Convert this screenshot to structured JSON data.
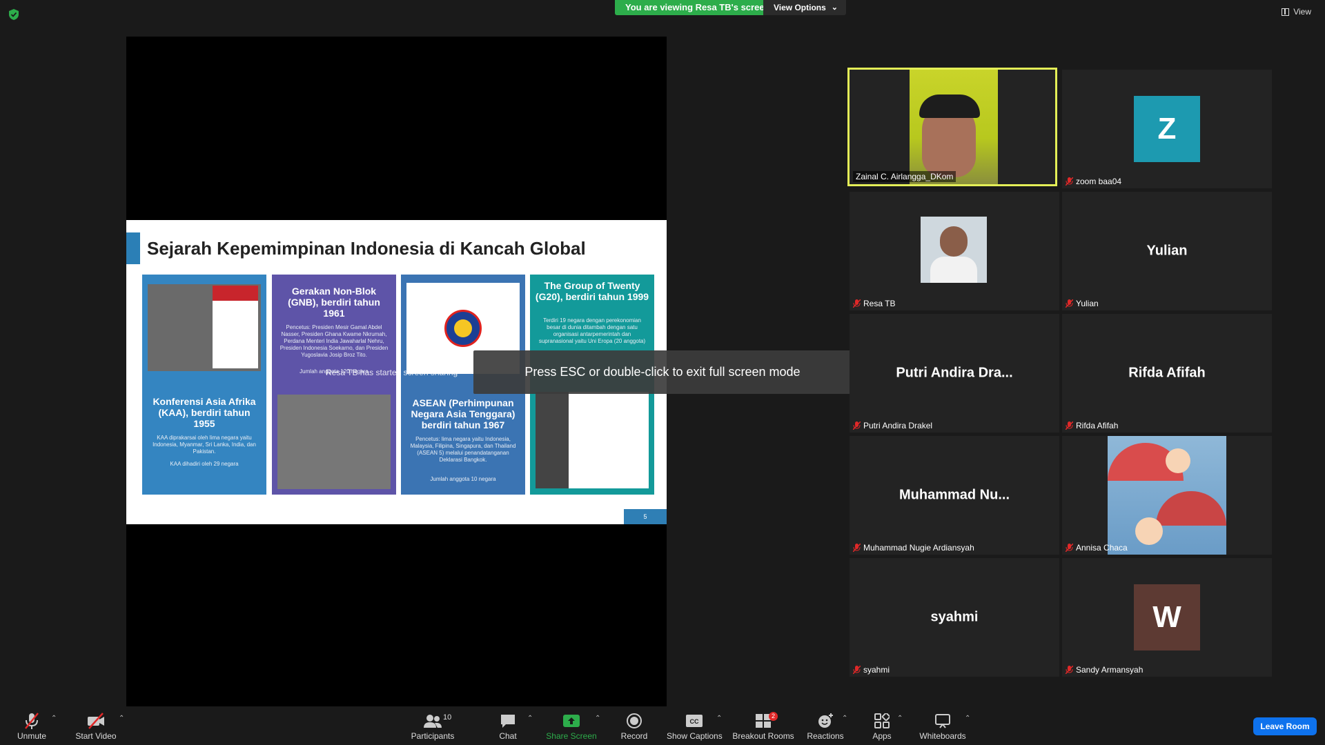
{
  "top": {
    "viewing_text": "You are viewing Resa TB's screen",
    "view_options_label": "View Options",
    "view_label": "View"
  },
  "slide": {
    "title": "Sejarah Kepemimpinan Indonesia di Kancah Global",
    "page_number": "5",
    "cards": [
      {
        "heading": "Konferensi Asia Afrika (KAA), berdiri tahun 1955",
        "body": "KAA diprakarsai oleh lima negara yaitu Indonesia, Myanmar, Sri Lanka, India, dan Pakistan.",
        "footer": "KAA dihadiri oleh 29 negara"
      },
      {
        "heading": "Gerakan Non-Blok (GNB), berdiri tahun 1961",
        "body": "Pencetus: Presiden Mesir Gamal Abdel Nasser, Presiden Ghana Kwame Nkrumah, Perdana Menteri India Jawaharlal Nehru, Presiden Indonesia Soekarno, dan Presiden Yugoslavia Josip Broz Tito.",
        "footer": "Jumlah anggota 120 negara"
      },
      {
        "heading": "ASEAN (Perhimpunan Negara Asia Tenggara) berdiri tahun 1967",
        "body": "Pencetus: lima negara yaitu Indonesia, Malaysia, Filipina, Singapura, dan Thailand (ASEAN 5) melalui penandatanganan Deklarasi Bangkok.",
        "footer": "Jumlah anggota 10 negara"
      },
      {
        "heading": "The Group of Twenty (G20), berdiri tahun 1999",
        "body": "Terdiri 19 negara dengan perekonomian besar di dunia ditambah dengan satu organisasi antarpemerintah dan supranasional yaitu Uni Eropa (20 anggota)",
        "footer": ""
      }
    ]
  },
  "overlay": {
    "esc_text": "Press ESC or double-click to exit full screen mode",
    "share_note": "Resa TB has started screen sharing"
  },
  "gallery": [
    {
      "name": "Zainal C. Airlangga_DKom",
      "center": "",
      "avatar": "",
      "muted": false
    },
    {
      "name": "zoom baa04",
      "center": "",
      "avatar": "Z",
      "muted": true
    },
    {
      "name": "Resa TB",
      "center": "",
      "avatar": "",
      "muted": true
    },
    {
      "name": "Yulian",
      "center": "Yulian",
      "avatar": "",
      "muted": true
    },
    {
      "name": "Putri Andira Drakel",
      "center": "Putri Andira Dra...",
      "avatar": "",
      "muted": true
    },
    {
      "name": "Rifda Afifah",
      "center": "Rifda Afifah",
      "avatar": "",
      "muted": true
    },
    {
      "name": "Muhammad Nugie Ardiansyah",
      "center": "Muhammad  Nu...",
      "avatar": "",
      "muted": true
    },
    {
      "name": "Annisa Chaca",
      "center": "",
      "avatar": "",
      "muted": true
    },
    {
      "name": "syahmi",
      "center": "syahmi",
      "avatar": "",
      "muted": true
    },
    {
      "name": "Sandy Armansyah",
      "center": "",
      "avatar": "W",
      "muted": true
    }
  ],
  "colors": {
    "avatar_z": "#1d9ab0",
    "avatar_w": "#5d3a33",
    "active_border": "#e4ef57",
    "share_green": "#2dad4b"
  },
  "toolbar": {
    "unmute": "Unmute",
    "start_video": "Start Video",
    "participants": "Participants",
    "participants_count": "10",
    "chat": "Chat",
    "share_screen": "Share Screen",
    "record": "Record",
    "show_captions": "Show Captions",
    "breakout_rooms": "Breakout Rooms",
    "breakout_badge": "2",
    "reactions": "Reactions",
    "apps": "Apps",
    "whiteboards": "Whiteboards",
    "leave_room": "Leave Room"
  }
}
